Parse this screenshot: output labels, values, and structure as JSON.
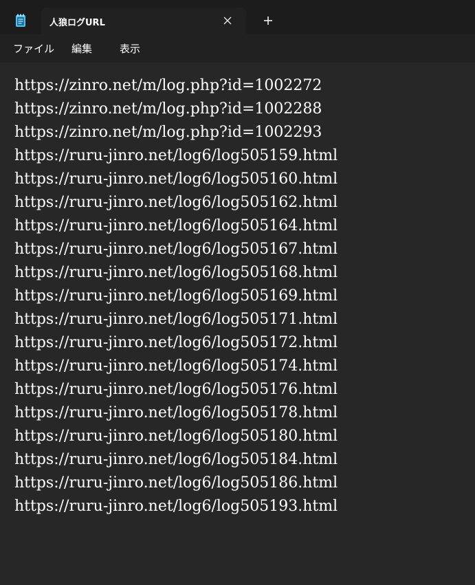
{
  "tab": {
    "title": "人狼ログURL",
    "new_tab_symbol": "+"
  },
  "icons": {
    "app": "notepad-icon",
    "close": "close-icon",
    "new_tab": "plus-icon"
  },
  "menu": {
    "items": [
      "ファイル",
      "編集",
      "表示"
    ]
  },
  "editor": {
    "lines": [
      "https://zinro.net/m/log.php?id=1002272",
      "https://zinro.net/m/log.php?id=1002288",
      "https://zinro.net/m/log.php?id=1002293",
      "https://ruru-jinro.net/log6/log505159.html",
      "https://ruru-jinro.net/log6/log505160.html",
      "https://ruru-jinro.net/log6/log505162.html",
      "https://ruru-jinro.net/log6/log505164.html",
      "https://ruru-jinro.net/log6/log505167.html",
      "https://ruru-jinro.net/log6/log505168.html",
      "https://ruru-jinro.net/log6/log505169.html",
      "https://ruru-jinro.net/log6/log505171.html",
      "https://ruru-jinro.net/log6/log505172.html",
      "https://ruru-jinro.net/log6/log505174.html",
      "https://ruru-jinro.net/log6/log505176.html",
      "https://ruru-jinro.net/log6/log505178.html",
      "https://ruru-jinro.net/log6/log505180.html",
      "https://ruru-jinro.net/log6/log505184.html",
      "https://ruru-jinro.net/log6/log505186.html",
      "https://ruru-jinro.net/log6/log505193.html"
    ]
  },
  "colors": {
    "titlebar": "#1c1c1c",
    "tab_active": "#212121",
    "editor_bg": "#272727",
    "text": "#ffffff",
    "icon_accent": "#4ec3f2"
  }
}
